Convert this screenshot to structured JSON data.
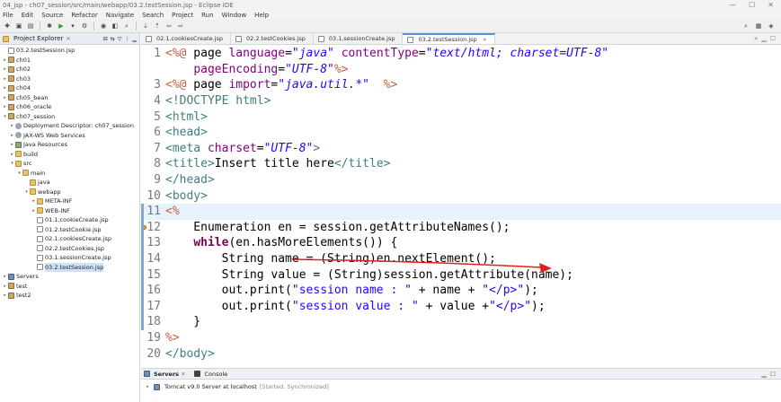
{
  "window": {
    "title": "04_jsp - ch07_session/src/main/webapp/03.2.testSession.jsp - Eclipse IDE",
    "controls": [
      "—",
      "☐",
      "✕"
    ]
  },
  "menu": [
    "File",
    "Edit",
    "Source",
    "Refactor",
    "Navigate",
    "Search",
    "Project",
    "Run",
    "Window",
    "Help"
  ],
  "explorer": {
    "tab_label": "Project Explorer",
    "tree": [
      {
        "label": "03.2.testSession.jsp",
        "depth": 0,
        "icon": "file"
      },
      {
        "label": "ch01",
        "depth": 0,
        "icon": "proj",
        "arrow": "▸"
      },
      {
        "label": "ch02",
        "depth": 0,
        "icon": "proj",
        "arrow": "▸"
      },
      {
        "label": "ch03",
        "depth": 0,
        "icon": "proj",
        "arrow": "▸"
      },
      {
        "label": "ch04",
        "depth": 0,
        "icon": "proj",
        "arrow": "▸"
      },
      {
        "label": "ch05_bean",
        "depth": 0,
        "icon": "proj",
        "arrow": "▸"
      },
      {
        "label": "ch06_oracle",
        "depth": 0,
        "icon": "proj",
        "arrow": "▸"
      },
      {
        "label": "ch07_session",
        "depth": 0,
        "icon": "proj",
        "arrow": "▾"
      },
      {
        "label": "Deployment Descriptor: ch07_session",
        "depth": 1,
        "icon": "gear",
        "arrow": "▸"
      },
      {
        "label": "JAX-WS Web Services",
        "depth": 1,
        "icon": "gear",
        "arrow": "▸"
      },
      {
        "label": "Java Resources",
        "depth": 1,
        "icon": "lib",
        "arrow": "▸"
      },
      {
        "label": "build",
        "depth": 1,
        "icon": "folder",
        "arrow": "▸"
      },
      {
        "label": "src",
        "depth": 1,
        "icon": "folder",
        "arrow": "▾"
      },
      {
        "label": "main",
        "depth": 2,
        "icon": "folder",
        "arrow": "▾"
      },
      {
        "label": "java",
        "depth": 3,
        "icon": "folder",
        "arrow": ""
      },
      {
        "label": "webapp",
        "depth": 3,
        "icon": "folder",
        "arrow": "▾"
      },
      {
        "label": "META-INF",
        "depth": 4,
        "icon": "folder",
        "arrow": "▸"
      },
      {
        "label": "WEB-INF",
        "depth": 4,
        "icon": "folder",
        "arrow": "▸"
      },
      {
        "label": "01.1.cookieCreate.jsp",
        "depth": 4,
        "icon": "file",
        "arrow": ""
      },
      {
        "label": "01.2.testCookie.jsp",
        "depth": 4,
        "icon": "file",
        "arrow": ""
      },
      {
        "label": "02.1.cookiesCreate.jsp",
        "depth": 4,
        "icon": "file",
        "arrow": ""
      },
      {
        "label": "02.2.testCookies.jsp",
        "depth": 4,
        "icon": "file",
        "arrow": ""
      },
      {
        "label": "03.1.sessionCreate.jsp",
        "depth": 4,
        "icon": "file",
        "arrow": ""
      },
      {
        "label": "03.2.testSession.jsp",
        "depth": 4,
        "icon": "file",
        "arrow": "",
        "selected": true
      },
      {
        "label": "Servers",
        "depth": 0,
        "icon": "srv",
        "arrow": "▸"
      },
      {
        "label": "test",
        "depth": 0,
        "icon": "proj",
        "arrow": "▸"
      },
      {
        "label": "test2",
        "depth": 0,
        "icon": "proj",
        "arrow": "▸"
      }
    ]
  },
  "editor_tabs": [
    {
      "label": "02.1.cookiesCreate.jsp",
      "active": false
    },
    {
      "label": "02.2.testCookies.jsp",
      "active": false
    },
    {
      "label": "03.1.sessionCreate.jsp",
      "active": false
    },
    {
      "label": "03.2.testSession.jsp",
      "active": true
    }
  ],
  "code_lines": [
    {
      "n": "1",
      "html": "<span class=\"dir\">&lt;%@</span> page <span class=\"attr\">language</span>=<span class=\"str\">\"java\"</span> <span class=\"attr\">contentType</span>=<span class=\"str\">\"text/html; charset=UTF-8\"</span>"
    },
    {
      "n": "",
      "html": "    <span class=\"attr\">pageEncoding</span>=<span class=\"str\">\"UTF-8\"</span><span class=\"dir\">%&gt;</span>"
    },
    {
      "n": "3",
      "html": "<span class=\"dir\">&lt;%@</span> page <span class=\"attr\">import</span>=<span class=\"str\">\"java.util.*\"</span>  <span class=\"dir\">%&gt;</span>"
    },
    {
      "n": "4",
      "html": "<span class=\"tag\">&lt;!DOCTYPE html&gt;</span>"
    },
    {
      "n": "5",
      "html": "<span class=\"tag\">&lt;html&gt;</span>"
    },
    {
      "n": "6",
      "html": "<span class=\"tag\">&lt;head&gt;</span>"
    },
    {
      "n": "7",
      "html": "<span class=\"tag\">&lt;meta</span> <span class=\"attr\">charset</span>=<span class=\"str\">\"UTF-8\"</span><span class=\"tag\">&gt;</span>"
    },
    {
      "n": "8",
      "html": "<span class=\"tag\">&lt;title&gt;</span>Insert title here<span class=\"tag\">&lt;/title&gt;</span>"
    },
    {
      "n": "9",
      "html": "<span class=\"tag\">&lt;/head&gt;</span>"
    },
    {
      "n": "10",
      "html": "<span class=\"tag\">&lt;body&gt;</span>"
    },
    {
      "n": "11",
      "html": "<span class=\"dir\">&lt;%</span>",
      "highlight": true
    },
    {
      "n": "12",
      "html": "    Enumeration en = session.getAttributeNames();",
      "warn": true
    },
    {
      "n": "13",
      "html": "    <span class=\"kw\">while</span>(en.hasMoreElements()) {"
    },
    {
      "n": "14",
      "html": "        String name = (String)en.nextElement();"
    },
    {
      "n": "15",
      "html": "        String value = (String)session.getAttribute(name);"
    },
    {
      "n": "16",
      "html": "        out.print(<span class=\"str2\">\"session name : \"</span> + name + <span class=\"str2\">\"&lt;/p&gt;\"</span>);"
    },
    {
      "n": "17",
      "html": "        out.print(<span class=\"str2\">\"session value : \"</span> + value +<span class=\"str2\">\"&lt;/p&gt;\"</span>);"
    },
    {
      "n": "18",
      "html": "    }"
    },
    {
      "n": "19",
      "html": "<span class=\"dir\">%&gt;</span>"
    },
    {
      "n": "20",
      "html": "<span class=\"tag\">&lt;/body&gt;</span>"
    }
  ],
  "bottom": {
    "tabs": [
      {
        "label": "Servers",
        "active": true
      },
      {
        "label": "Console",
        "active": false
      }
    ],
    "server_row": "Tomcat v9.0 Server at localhost",
    "server_status": "[Started, Synchronized]"
  },
  "colors": {
    "accent": "#5b8fd6",
    "annotation_arrow": "#e02020"
  }
}
